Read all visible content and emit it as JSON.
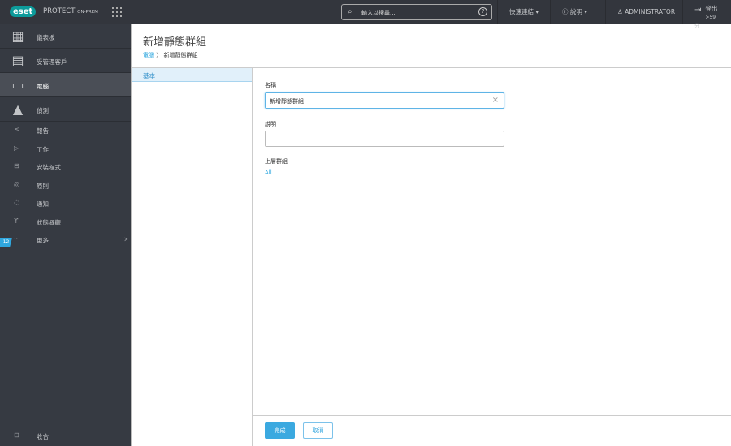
{
  "header": {
    "logo": "eset",
    "product": "PROTECT",
    "product_suffix": "ON-PREM",
    "search_placeholder": "輸入以搜尋...",
    "quick_links": "快速連結",
    "help": "說明",
    "user": "ADMINISTRATOR",
    "logout": "登出",
    "logout_time": ">59 分"
  },
  "sidebar": {
    "primary": [
      {
        "label": "儀表板",
        "icon": "dashboard-icon"
      },
      {
        "label": "受管理客戶",
        "icon": "building-icon"
      },
      {
        "label": "電腦",
        "icon": "computers-icon",
        "selected": true
      },
      {
        "label": "偵測",
        "icon": "warning-icon"
      }
    ],
    "secondary": [
      {
        "label": "報告",
        "icon": "reports-icon"
      },
      {
        "label": "工作",
        "icon": "tasks-icon"
      },
      {
        "label": "安裝程式",
        "icon": "installer-icon"
      },
      {
        "label": "原則",
        "icon": "policy-icon"
      },
      {
        "label": "通知",
        "icon": "notification-icon"
      },
      {
        "label": "狀態概觀",
        "icon": "status-icon"
      },
      {
        "label": "更多",
        "icon": "more-icon"
      }
    ],
    "badge": "12",
    "collapse": "收合"
  },
  "page": {
    "title": "新增靜態群組",
    "breadcrumb": [
      "電腦",
      "新增靜態群組"
    ],
    "tab": "基本"
  },
  "form": {
    "name_label": "名稱",
    "name_value": "新增靜態群組",
    "desc_label": "說明",
    "desc_value": "",
    "parent_label": "上層群組",
    "parent_value": "All"
  },
  "footer": {
    "finish": "完成",
    "cancel": "取消"
  },
  "colors": {
    "accent": "#2fa7df",
    "sidebar": "#363a42",
    "header": "#33363d",
    "brand": "#0d9b9b"
  }
}
